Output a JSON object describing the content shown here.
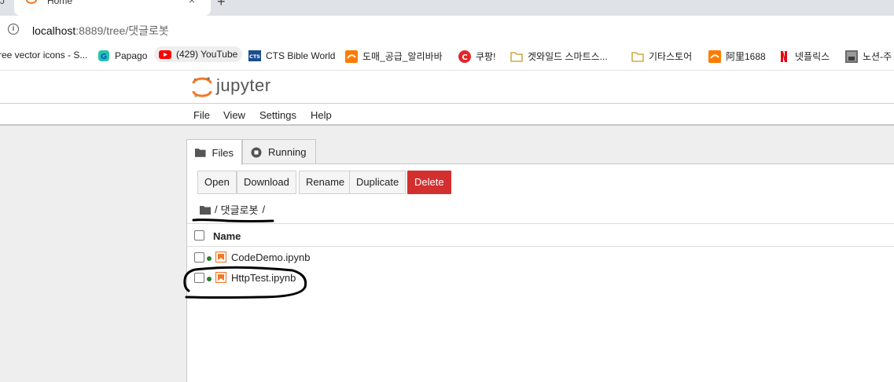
{
  "browser": {
    "tab_fragment": "J",
    "active_tab_title": "Home",
    "tab_close": "×",
    "new_tab": "+",
    "url_host": "localhost",
    "url_rest": ":8889/tree/댓글로봇",
    "bookmarks": [
      {
        "label": "ree vector icons - S...",
        "icon": "none"
      },
      {
        "label": "Papago",
        "icon": "papago-icon"
      },
      {
        "label": "(429) YouTube",
        "icon": "youtube-icon"
      },
      {
        "label": "CTS Bible World",
        "icon": "cts-icon"
      },
      {
        "label": "도매_공급_알리바바",
        "icon": "alibaba-icon"
      },
      {
        "label": "쿠팡!",
        "icon": "coupang-icon"
      },
      {
        "label": "겟와일드 스마트스...",
        "icon": "folder-icon"
      },
      {
        "label": "기타스토어",
        "icon": "folder-icon"
      },
      {
        "label": "阿里1688",
        "icon": "alibaba-icon"
      },
      {
        "label": "넷플릭스",
        "icon": "netflix-icon"
      },
      {
        "label": "노션-주",
        "icon": "notion-icon"
      }
    ]
  },
  "jupyter": {
    "wordmark": "jupyter",
    "menu": [
      "File",
      "View",
      "Settings",
      "Help"
    ],
    "tabs": [
      {
        "label": "Files",
        "icon": "folder-icon",
        "active": true
      },
      {
        "label": "Running",
        "icon": "stop-circle-icon",
        "active": false
      }
    ],
    "toolbar": {
      "open": "Open",
      "download": "Download",
      "rename": "Rename",
      "duplicate": "Duplicate",
      "delete": "Delete"
    },
    "breadcrumb": {
      "sep1": "/",
      "folder": "댓글로봇",
      "sep2": "/"
    },
    "list": {
      "column_name": "Name",
      "files": [
        {
          "name": "CodeDemo.ipynb",
          "running": true
        },
        {
          "name": "HttpTest.ipynb",
          "running": true
        }
      ]
    }
  },
  "colors": {
    "jupyter_orange": "#f37726",
    "danger": "#d32f2f",
    "running_green": "#2e7d32"
  }
}
